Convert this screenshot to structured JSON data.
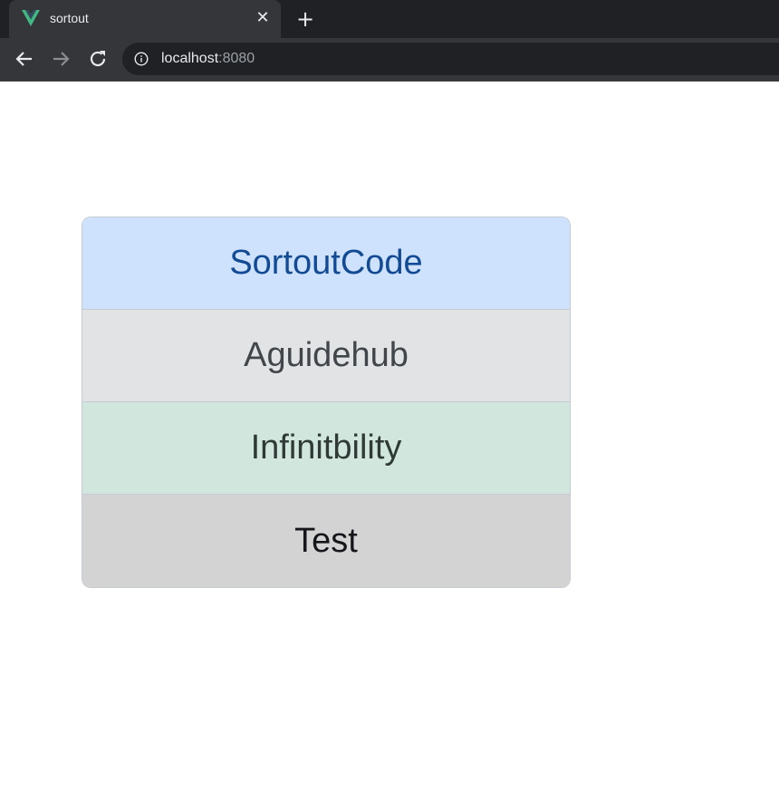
{
  "browser": {
    "tab": {
      "title": "sortout",
      "favicon": "vue-logo-icon",
      "close_symbol": "✕"
    },
    "new_tab_symbol": "+",
    "address": {
      "host": "localhost",
      "port": ":8080"
    },
    "colors": {
      "tab_strip": "#202124",
      "toolbar": "#35363a",
      "omnibox": "#202124"
    }
  },
  "page": {
    "list_items": [
      {
        "label": "SortoutCode",
        "variant": "primary",
        "bg": "#cfe2fd",
        "color": "#124b94"
      },
      {
        "label": "Aguidehub",
        "variant": "secondary",
        "bg": "#e2e3e5",
        "color": "#41464b"
      },
      {
        "label": "Infinitbility",
        "variant": "success",
        "bg": "#d1e7dd",
        "color": "#2f3a37"
      },
      {
        "label": "Test",
        "variant": "dark",
        "bg": "#d3d3d4",
        "color": "#141619"
      }
    ]
  }
}
